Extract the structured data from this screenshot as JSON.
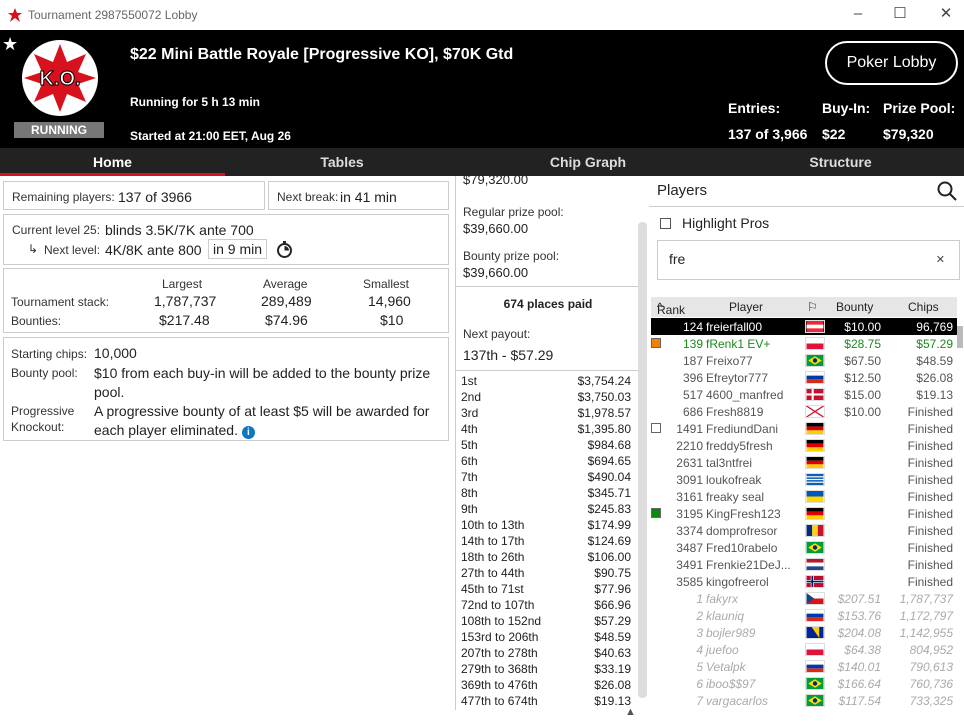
{
  "window": {
    "title": "Tournament 2987550072 Lobby"
  },
  "header": {
    "name": "$22 Mini Battle Royale [Progressive KO], $70K Gtd",
    "running_for": "Running for 5 h 13 min",
    "started": "Started at 21:00 EET, Aug 26",
    "status": "RUNNING",
    "badge_text": "K.O.",
    "lobby_button": "Poker Lobby",
    "entries_label": "Entries:",
    "entries_value": "137 of 3,966",
    "buyin_label": "Buy-In:",
    "buyin_value": "$22",
    "prize_label": "Prize Pool:",
    "prize_value": "$79,320"
  },
  "tabs": [
    "Home",
    "Tables",
    "Chip Graph",
    "Structure"
  ],
  "info": {
    "remaining_label": "Remaining players:",
    "remaining_value": "137 of 3966",
    "nextbreak_label": "Next break:",
    "nextbreak_value": "in 41 min",
    "level_label": "Current level 25:",
    "level_value": "blinds 3.5K/7K ante 700",
    "nextlevel_label": "Next level:",
    "nextlevel_value": "4K/8K ante 800",
    "nextlevel_time": "in 9 min",
    "stack_headers": [
      "Largest",
      "Average",
      "Smallest"
    ],
    "stack_label": "Tournament stack:",
    "stack_values": [
      "1,787,737",
      "289,489",
      "14,960"
    ],
    "bounty_label": "Bounties:",
    "bounty_values": [
      "$217.48",
      "$74.96",
      "$10"
    ],
    "starting_label": "Starting chips:",
    "starting_value": "10,000",
    "bountypool_label": "Bounty pool:",
    "bountypool_value": "$10 from each buy-in will be added to the bounty prize pool.",
    "pko_label1": "Progressive",
    "pko_label2": "Knockout:",
    "pko_value": "A progressive bounty of at least $5 will be awarded for each player eliminated."
  },
  "prizes": {
    "top_cut": "$79,320.00",
    "regular_label": "Regular prize pool:",
    "regular_value": "$39,660.00",
    "bounty_label": "Bounty prize pool:",
    "bounty_value": "$39,660.00",
    "paid": "674 places paid",
    "next_label": "Next payout:",
    "next_value": "137th - $57.29",
    "rows": [
      [
        "1st",
        "$3,754.24"
      ],
      [
        "2nd",
        "$3,750.03"
      ],
      [
        "3rd",
        "$1,978.57"
      ],
      [
        "4th",
        "$1,395.80"
      ],
      [
        "5th",
        "$984.68"
      ],
      [
        "6th",
        "$694.65"
      ],
      [
        "7th",
        "$490.04"
      ],
      [
        "8th",
        "$345.71"
      ],
      [
        "9th",
        "$245.83"
      ],
      [
        "10th to 13th",
        "$174.99"
      ],
      [
        "14th to 17th",
        "$124.69"
      ],
      [
        "18th to 26th",
        "$106.00"
      ],
      [
        "27th to 44th",
        "$90.75"
      ],
      [
        "45th to 71st",
        "$77.96"
      ],
      [
        "72nd to 107th",
        "$66.96"
      ],
      [
        "108th to 152nd",
        "$57.29"
      ],
      [
        "153rd to 206th",
        "$48.59"
      ],
      [
        "207th to 278th",
        "$40.63"
      ],
      [
        "279th to 368th",
        "$33.19"
      ],
      [
        "369th to 476th",
        "$26.08"
      ],
      [
        "477th to 674th",
        "$19.13"
      ]
    ]
  },
  "players": {
    "title": "Players",
    "highlight_label": "Highlight Pros",
    "search_value": "fre",
    "columns": [
      "Rank",
      "Player",
      "Bounty",
      "Chips"
    ],
    "rows": [
      {
        "rank": "124",
        "name": "freierfall00",
        "bounty": "$10.00",
        "chips": "96,769",
        "style": "sel",
        "flag": "at"
      },
      {
        "rank": "139",
        "name": "fRenk1 EV+",
        "bounty": "$28.75",
        "chips": "$57.29",
        "style": "green",
        "flag": "pl",
        "mark": "#f08000"
      },
      {
        "rank": "187",
        "name": "Freixo77",
        "bounty": "$67.50",
        "chips": "$48.59",
        "style": "gray",
        "flag": "br"
      },
      {
        "rank": "396",
        "name": "Efreytor777",
        "bounty": "$12.50",
        "chips": "$26.08",
        "style": "gray",
        "flag": "ru"
      },
      {
        "rank": "517",
        "name": "4600_manfred",
        "bounty": "$15.00",
        "chips": "$19.13",
        "style": "gray",
        "flag": "dk"
      },
      {
        "rank": "686",
        "name": "Fresh8819",
        "bounty": "$10.00",
        "chips": "Finished",
        "style": "gray",
        "flag": "gb"
      },
      {
        "rank": "1491",
        "name": "FrediundDani",
        "bounty": "",
        "chips": "Finished",
        "style": "gray",
        "flag": "de",
        "mark": "#fff"
      },
      {
        "rank": "2210",
        "name": "freddy5fresh",
        "bounty": "",
        "chips": "Finished",
        "style": "gray",
        "flag": "de"
      },
      {
        "rank": "2631",
        "name": "tal3ntfrei",
        "bounty": "",
        "chips": "Finished",
        "style": "gray",
        "flag": "de"
      },
      {
        "rank": "3091",
        "name": "loukofreak",
        "bounty": "",
        "chips": "Finished",
        "style": "gray",
        "flag": "gr"
      },
      {
        "rank": "3161",
        "name": "freaky seal",
        "bounty": "",
        "chips": "Finished",
        "style": "gray",
        "flag": "ua"
      },
      {
        "rank": "3195",
        "name": "KingFresh123",
        "bounty": "",
        "chips": "Finished",
        "style": "gray",
        "flag": "de",
        "mark": "#0a8a0a"
      },
      {
        "rank": "3374",
        "name": "domprofresor",
        "bounty": "",
        "chips": "Finished",
        "style": "gray",
        "flag": "ro"
      },
      {
        "rank": "3487",
        "name": "Fred10rabelo",
        "bounty": "",
        "chips": "Finished",
        "style": "gray",
        "flag": "br"
      },
      {
        "rank": "3491",
        "name": "Frenkie21DeJ...",
        "bounty": "",
        "chips": "Finished",
        "style": "gray",
        "flag": "nl"
      },
      {
        "rank": "3585",
        "name": "kingofreerol",
        "bounty": "",
        "chips": "Finished",
        "style": "gray",
        "flag": "no"
      },
      {
        "rank": "1",
        "name": "fakyrx",
        "bounty": "$207.51",
        "chips": "1,787,737",
        "style": "ital",
        "flag": "cz"
      },
      {
        "rank": "2",
        "name": "klauniq",
        "bounty": "$153.76",
        "chips": "1,172,797",
        "style": "ital",
        "flag": "ru"
      },
      {
        "rank": "3",
        "name": "bojler989",
        "bounty": "$204.08",
        "chips": "1,142,955",
        "style": "ital",
        "flag": "ba"
      },
      {
        "rank": "4",
        "name": "juefoo",
        "bounty": "$64.38",
        "chips": "804,952",
        "style": "ital",
        "flag": "pl"
      },
      {
        "rank": "5",
        "name": "Vetalpk",
        "bounty": "$140.01",
        "chips": "790,613",
        "style": "ital",
        "flag": "ru"
      },
      {
        "rank": "6",
        "name": "iboo$$97",
        "bounty": "$166.64",
        "chips": "760,736",
        "style": "ital",
        "flag": "br"
      },
      {
        "rank": "7",
        "name": "vargacarlos",
        "bounty": "$117.54",
        "chips": "733,325",
        "style": "ital",
        "flag": "br"
      }
    ]
  }
}
